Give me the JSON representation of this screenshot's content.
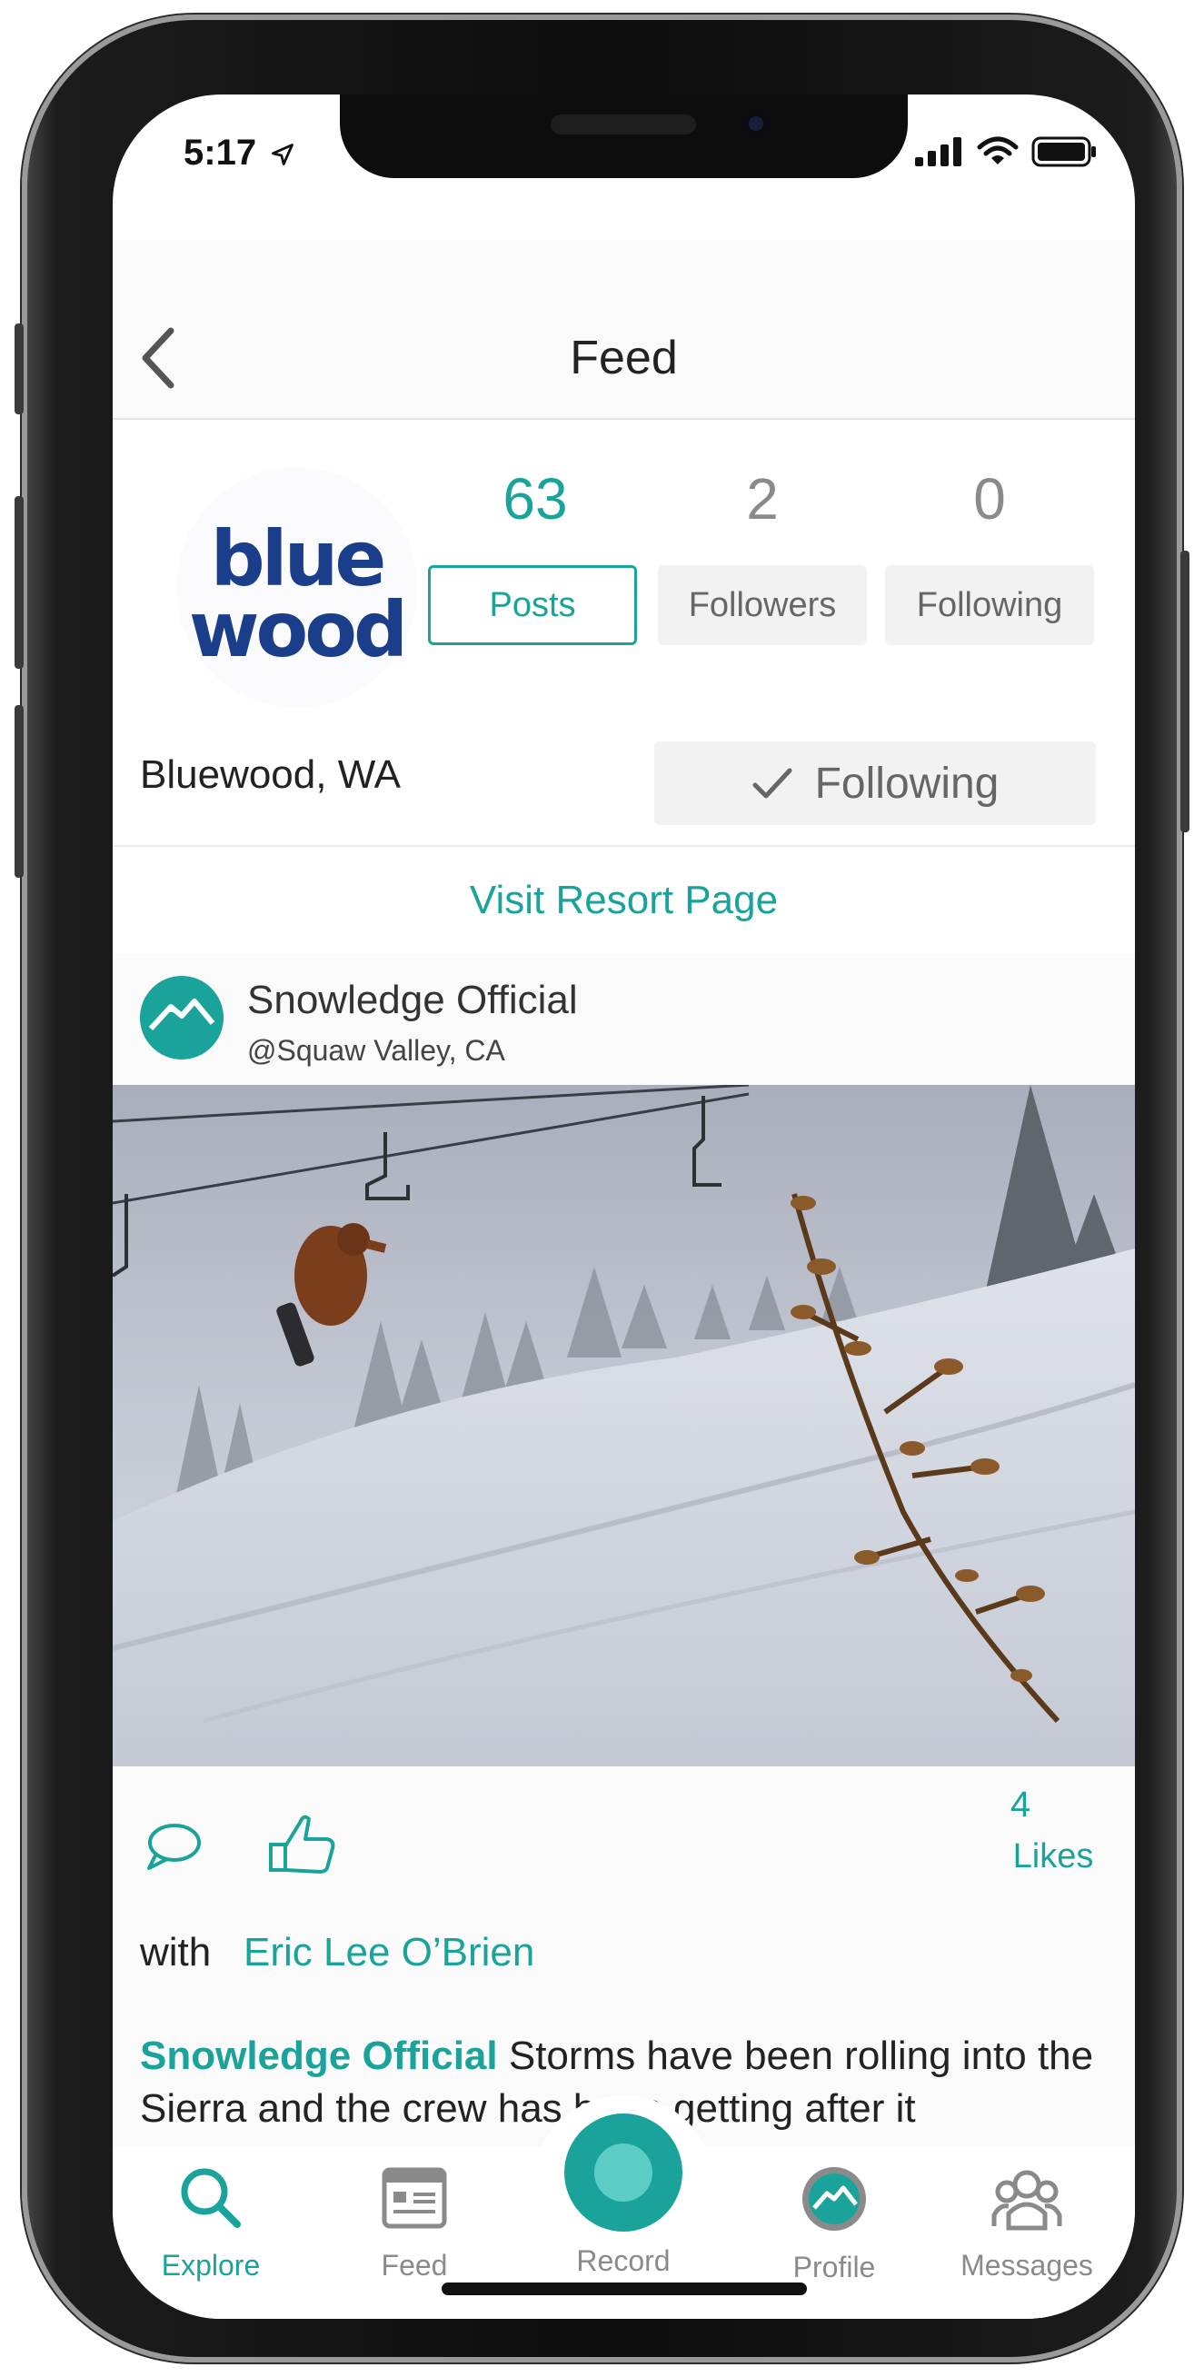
{
  "status": {
    "time": "5:17"
  },
  "nav": {
    "title": "Feed"
  },
  "profile": {
    "logo_line1": "blue",
    "logo_line2": "wood",
    "stats": [
      {
        "value": "63",
        "label": "Posts"
      },
      {
        "value": "2",
        "label": "Followers"
      },
      {
        "value": "0",
        "label": "Following"
      }
    ],
    "location": "Bluewood, WA",
    "follow_button": "Following",
    "visit_link": "Visit Resort Page"
  },
  "post": {
    "user": "Snowledge Official",
    "location": "@Squaw Valley, CA",
    "likes_count": "4",
    "likes_label": "Likes",
    "with_label": "with",
    "with_name": "Eric Lee O’Brien",
    "caption_user": "Snowledge Official",
    "caption_text": "Storms have been rolling into the Sierra and the crew has been getting after it"
  },
  "tabs": [
    {
      "label": "Explore"
    },
    {
      "label": "Feed"
    },
    {
      "label": "Record"
    },
    {
      "label": "Profile"
    },
    {
      "label": "Messages"
    }
  ],
  "colors": {
    "accent": "#1aa39a",
    "logo_blue": "#1b3e8a"
  }
}
